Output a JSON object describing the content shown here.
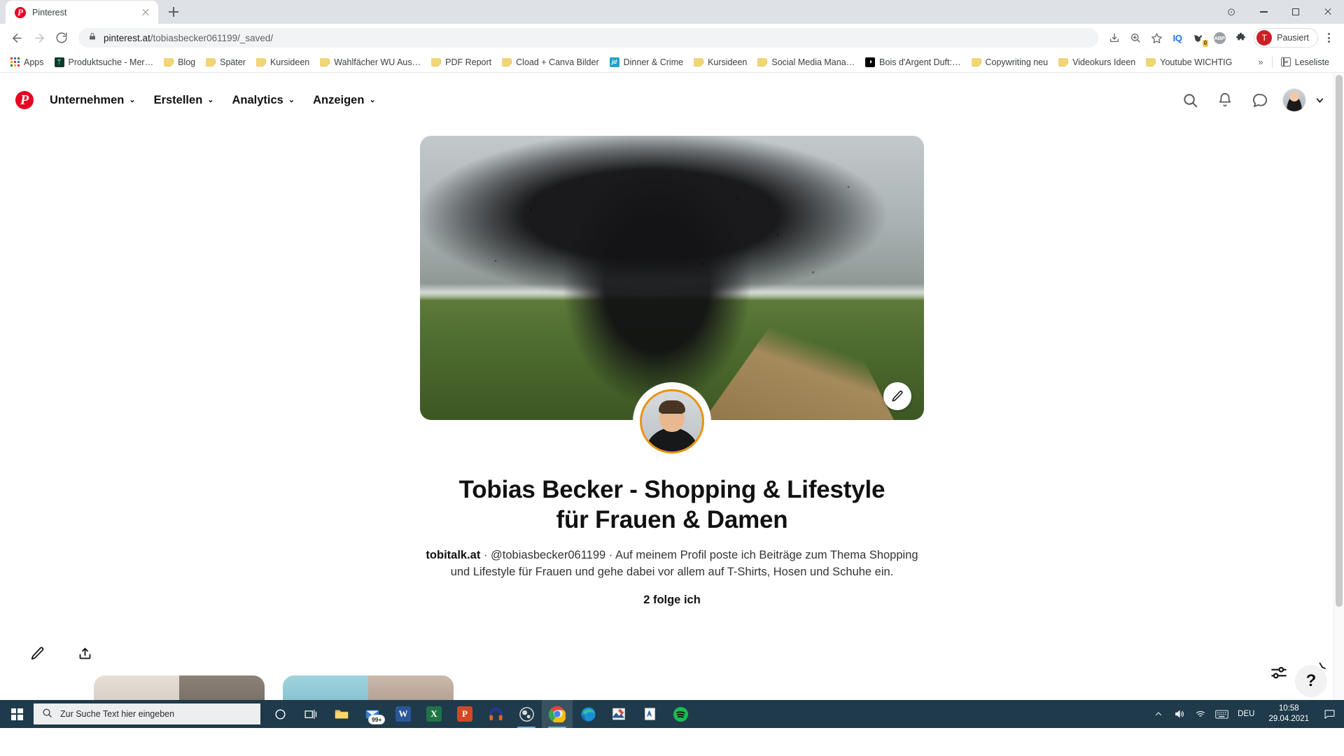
{
  "browser": {
    "tab": {
      "title": "Pinterest",
      "favicon": "pinterest-icon"
    },
    "new_tab_label": "+",
    "window_controls": {
      "minimize": "minimize-icon",
      "maximize": "maximize-icon",
      "close": "close-icon",
      "extra": "record-dot-icon"
    },
    "nav": {
      "back": "back-arrow-icon",
      "forward": "forward-arrow-icon",
      "reload": "reload-icon"
    },
    "omnibox": {
      "lock": "lock-icon",
      "url_host": "pinterest.at",
      "url_path": "/tobiasbecker061199/_saved/",
      "full_url": "pinterest.at/tobiasbecker061199/_saved/"
    },
    "toolbar_icons": [
      {
        "name": "install-page-icon",
        "glyph": "install"
      },
      {
        "name": "zoom-icon",
        "glyph": "zoom"
      },
      {
        "name": "bookmark-star-icon",
        "glyph": "star"
      },
      {
        "name": "iq-extension-icon",
        "glyph": "IQ"
      },
      {
        "name": "bird-extension-icon",
        "glyph": "bird",
        "badge": "0"
      },
      {
        "name": "adblock-plus-icon",
        "glyph": "ABP"
      },
      {
        "name": "extensions-puzzle-icon",
        "glyph": "puzzle"
      }
    ],
    "profile": {
      "initial": "T",
      "label": "Pausiert"
    },
    "menu": "kebab-menu-icon",
    "bookmarks": [
      {
        "label": "Apps",
        "icon": "apps-grid-icon"
      },
      {
        "label": "Produktsuche - Mer…",
        "icon": "site-favicon",
        "color": "#1f4c3a"
      },
      {
        "label": "Blog",
        "icon": "folder-icon"
      },
      {
        "label": "Später",
        "icon": "folder-icon"
      },
      {
        "label": "Kursideen",
        "icon": "folder-icon"
      },
      {
        "label": "Wahlfächer WU Aus…",
        "icon": "folder-icon"
      },
      {
        "label": "PDF Report",
        "icon": "folder-icon"
      },
      {
        "label": "Cload + Canva Bilder",
        "icon": "folder-icon"
      },
      {
        "label": "Dinner & Crime",
        "icon": "site-favicon",
        "color": "#1fa0c9",
        "text": "jd"
      },
      {
        "label": "Kursideen",
        "icon": "folder-icon"
      },
      {
        "label": "Social Media Mana…",
        "icon": "folder-icon"
      },
      {
        "label": "Bois d'Argent Duft:…",
        "icon": "site-favicon",
        "color": "#000000",
        "text": "◑"
      },
      {
        "label": "Copywriting neu",
        "icon": "folder-icon"
      },
      {
        "label": "Videokurs Ideen",
        "icon": "folder-icon"
      },
      {
        "label": "Youtube WICHTIG",
        "icon": "folder-icon"
      }
    ],
    "bookmarks_overflow": "»",
    "reading_list_label": "Leseliste"
  },
  "pinterest": {
    "logo": "pinterest-logo-icon",
    "nav": [
      {
        "label": "Unternehmen",
        "has_caret": true
      },
      {
        "label": "Erstellen",
        "has_caret": true
      },
      {
        "label": "Analytics",
        "has_caret": true
      },
      {
        "label": "Anzeigen",
        "has_caret": true
      }
    ],
    "header_actions": [
      {
        "name": "search-icon"
      },
      {
        "name": "notifications-bell-icon"
      },
      {
        "name": "messages-icon"
      },
      {
        "name": "account-avatar"
      },
      {
        "name": "chevron-down-icon"
      }
    ],
    "cover": {
      "name": "profile-cover-image",
      "edit_button": "edit-pencil-icon"
    },
    "avatar": "profile-avatar-image",
    "title": "Tobias Becker - Shopping & Lifestyle für Frauen & Damen",
    "website": "tobitalk.at",
    "separator": "·",
    "username": "@tobiasbecker061199",
    "description": "Auf meinem Profil poste ich Beiträge zum Thema Shopping und Lifestyle für Frauen und gehe dabei vor allem auf T-Shirts, Hosen und Schuhe ein.",
    "following": "2 folge ich",
    "board_actions": [
      {
        "name": "edit-pencil-icon"
      },
      {
        "name": "share-upload-icon"
      }
    ],
    "floating": {
      "tune": "tune-sliders-icon",
      "help": "?"
    }
  },
  "taskbar": {
    "start": "windows-start-icon",
    "search_placeholder": "Zur Suche Text hier eingeben",
    "search_icon": "search-icon",
    "cortana": "cortana-circle-icon",
    "taskview": "task-view-icon",
    "apps": [
      {
        "name": "file-explorer-icon",
        "glyph": "folder"
      },
      {
        "name": "mail-icon",
        "glyph": "mail",
        "badge": "99+"
      },
      {
        "name": "word-icon",
        "glyph": "W",
        "color": "#2b579a"
      },
      {
        "name": "excel-icon",
        "glyph": "X",
        "color": "#217346"
      },
      {
        "name": "powerpoint-icon",
        "glyph": "P",
        "color": "#d24726"
      },
      {
        "name": "audio-app-icon",
        "glyph": "headphones"
      },
      {
        "name": "obs-studio-icon",
        "glyph": "obs"
      },
      {
        "name": "google-chrome-icon",
        "glyph": "chrome",
        "active": true
      },
      {
        "name": "microsoft-edge-icon",
        "glyph": "edge"
      },
      {
        "name": "photo-editor-icon",
        "glyph": "photo"
      },
      {
        "name": "notepad-icon",
        "glyph": "note"
      },
      {
        "name": "spotify-icon",
        "glyph": "spotify"
      }
    ],
    "tray": {
      "overflow": "chevron-up-icon",
      "volume": "speaker-icon",
      "network": "wifi-icon",
      "keyboard": "keyboard-icon",
      "language": "DEU",
      "time": "10:58",
      "date": "29.04.2021",
      "notifications": "action-center-icon"
    }
  }
}
